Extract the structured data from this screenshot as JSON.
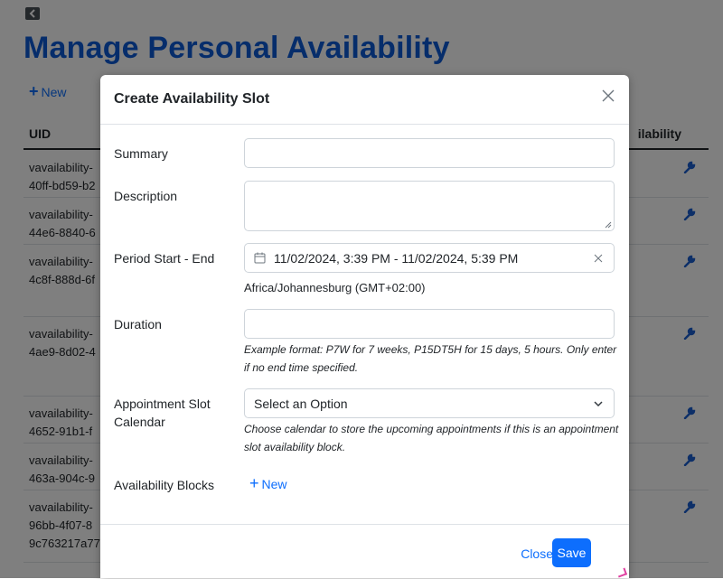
{
  "page": {
    "title": "Manage Personal Availability",
    "new_label": "New",
    "table": {
      "headers": {
        "uid": "UID",
        "availability": "ilability"
      },
      "rows": [
        {
          "uid": "vavailability-\n40ff-bd59-b2"
        },
        {
          "uid": "vavailability-\n44e6-8840-6"
        },
        {
          "uid": "vavailability-\n4c8f-888d-6f"
        },
        {
          "uid": "vavailability-\n4ae9-8d02-4"
        },
        {
          "uid": "vavailability-\n4652-91b1-f"
        },
        {
          "uid": "vavailability-\n463a-904c-9"
        },
        {
          "uid": "vavailability-\n96bb-4f07-8\n9c763217a77"
        }
      ]
    }
  },
  "modal": {
    "title": "Create Availability Slot",
    "fields": {
      "summary_label": "Summary",
      "summary_value": "",
      "description_label": "Description",
      "description_value": "",
      "period_label": "Period Start - End",
      "period_value": "11/02/2024, 3:39 PM - 11/02/2024, 5:39 PM",
      "timezone": "Africa/Johannesburg (GMT+02:00)",
      "duration_label": "Duration",
      "duration_value": "",
      "duration_help": "Example format: P7W for 7 weeks, P15DT5H for 15 days, 5 hours. Only enter if no end time specified.",
      "calendar_label": "Appointment Slot Calendar",
      "calendar_value": "Select an Option",
      "calendar_help": "Choose calendar to store the upcoming appointments if this is an appointment slot availability block.",
      "blocks_label": "Availability Blocks",
      "blocks_new_label": "New"
    },
    "footer": {
      "close_label": "Close",
      "save_label": "Save"
    }
  },
  "colors": {
    "primary": "#0d6efd",
    "title_blue": "#0d5bd7",
    "wrench": "#1a5fd0"
  },
  "icons": [
    "back-icon",
    "plus-icon",
    "wrench-icon",
    "close-icon",
    "calendar-icon",
    "clear-icon",
    "chevron-down-icon"
  ]
}
